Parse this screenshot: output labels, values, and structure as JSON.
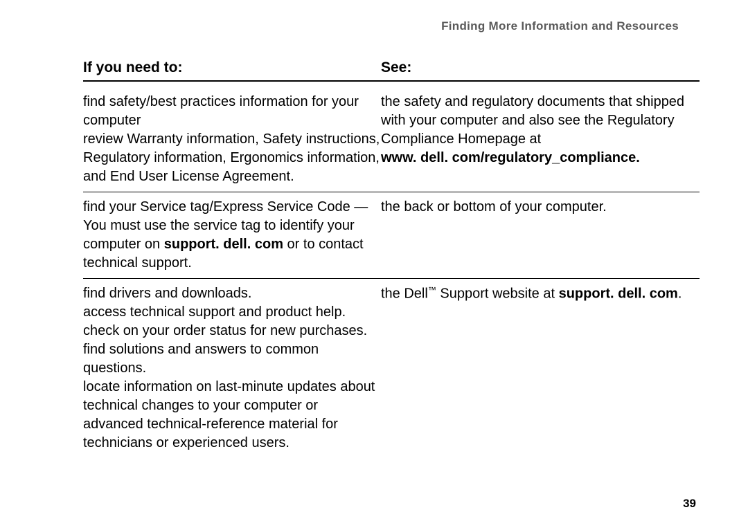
{
  "header": {
    "section_title": "Finding More Information and Resources"
  },
  "table": {
    "column_left_header": "If you need to:",
    "column_right_header": "See:",
    "rows": [
      {
        "left": {
          "line1": "find safety/best practices information for your computer",
          "line2": "review Warranty information, Safety instructions, Regulatory information, Ergonomics information, and End User License Agreement."
        },
        "right": {
          "line1": "the safety and regulatory documents that shipped with your computer and also see the Regulatory Compliance Homepage at",
          "bold_line": "www. dell. com/regulatory_compliance."
        }
      },
      {
        "left": {
          "line1_a": "find your Service tag/Express Service Code — You must use the service tag to identify your computer on ",
          "bold_inline": "support. dell. com",
          "line1_b": " or to contact technical support."
        },
        "right": {
          "line1": "the back or bottom of your computer."
        }
      },
      {
        "left": {
          "line1": "find drivers and downloads.",
          "line2": "access technical support and product help.",
          "line3": "check on your order status for new purchases.",
          "line4": "find solutions and answers to common questions.",
          "line5": "locate information on last-minute updates about technical changes to your computer or advanced technical-reference material for technicians or experienced users."
        },
        "right": {
          "line1_a": "the Dell",
          "tm": "™",
          "line1_b": " Support website at ",
          "bold_inline": "support. dell. com",
          "line1_c": "."
        }
      }
    ]
  },
  "footer": {
    "page_number": "39"
  }
}
